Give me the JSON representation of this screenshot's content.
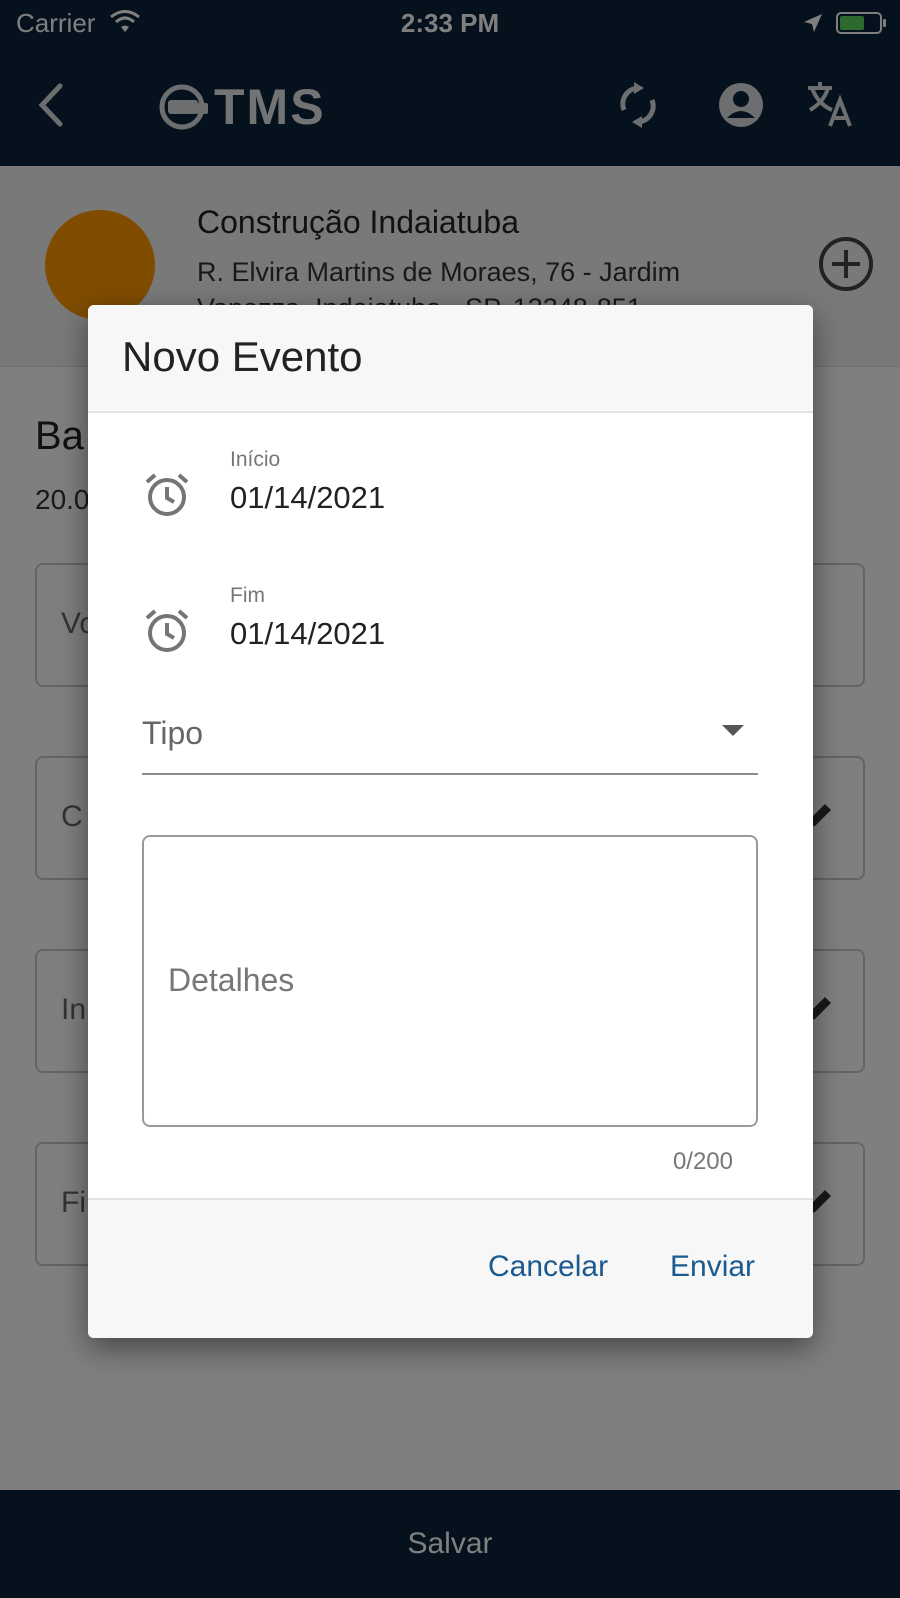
{
  "status_bar": {
    "carrier": "Carrier",
    "time": "2:33 PM"
  },
  "app_bar": {
    "logo_text": "TMS",
    "icons": [
      "back-arrow-icon",
      "sync-icon",
      "account-icon",
      "translate-icon"
    ]
  },
  "site": {
    "name": "Construção Indaiatuba",
    "address": "R. Elvira Martins de Moraes, 76 - Jardim Vanezza, Indaiatuba - SP, 13348-851",
    "avatar_color": "#ff9900"
  },
  "background_content": {
    "title_fragment": "Ba",
    "subtitle_fragment": "20.0",
    "field_fragments": [
      "Vo",
      "C",
      "In",
      "Fi"
    ]
  },
  "dialog": {
    "title": "Novo Evento",
    "start": {
      "label": "Início",
      "value": "01/14/2021"
    },
    "end": {
      "label": "Fim",
      "value": "01/14/2021"
    },
    "type_label": "Tipo",
    "details_placeholder": "Detalhes",
    "details_counter": "0/200",
    "cancel_label": "Cancelar",
    "send_label": "Enviar"
  },
  "bottom_bar": {
    "save_label": "Salvar"
  },
  "colors": {
    "primary_dark": "#0b2238",
    "accent_text": "#1b5a8f",
    "avatar": "#ff9900"
  }
}
